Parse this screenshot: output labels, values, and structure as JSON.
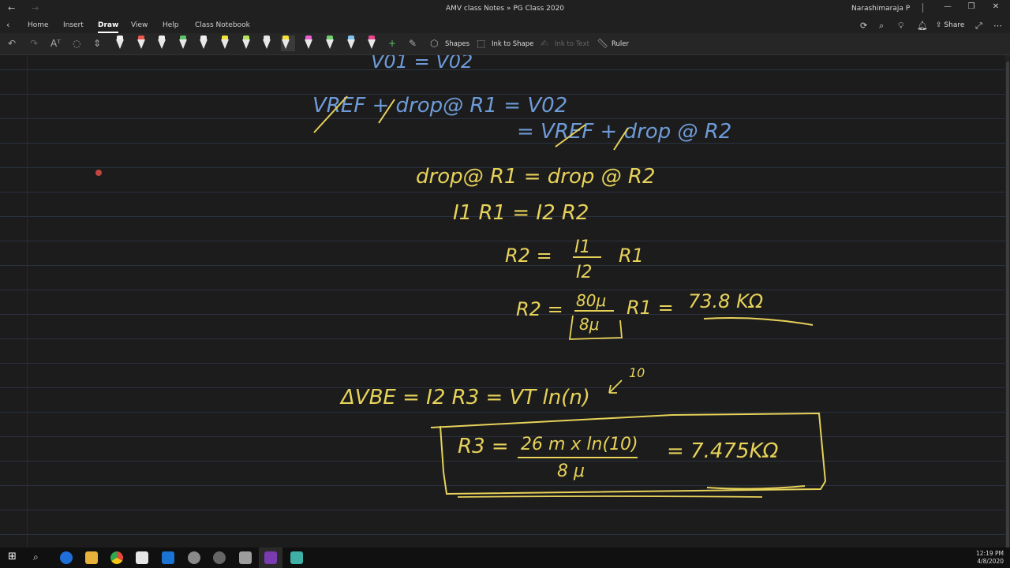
{
  "window": {
    "title": "AMV class Notes » PG Class 2020",
    "user": "Narashimaraja P"
  },
  "ribbon": {
    "tabs": [
      "Home",
      "Insert",
      "Draw",
      "View",
      "Help",
      "Class Notebook"
    ],
    "active_tab": "Draw",
    "share_label": "Share"
  },
  "toolbar": {
    "shapes_label": "Shapes",
    "ink_to_shape_label": "Ink to Shape",
    "ink_to_text_label": "Ink to Text",
    "ruler_label": "Ruler",
    "pen_colors": [
      "#f2f2f2",
      "#e8584f",
      "#eeeeee",
      "#5ec26b",
      "#f0f0f0",
      "#f4e23a",
      "#b4e45a",
      "#e6e6e6",
      "#f4e23a",
      "#e85fd0",
      "#6fd06f",
      "#7ec3f0",
      "#e8478e"
    ]
  },
  "notes": {
    "line1": "V01 = V02",
    "line2a": "VREF + drop@ R1 = V02",
    "line2b": "= VREF + drop @ R2",
    "eq1": "drop@ R1 = drop @ R2",
    "eq2": "I1 R1 = I2 R2",
    "eq3_lhs": "R2 =",
    "eq3_num": "I1",
    "eq3_den": "I2",
    "eq3_rhs": "R1",
    "eq4_lhs": "R2 =",
    "eq4_num": "80μ",
    "eq4_den": "8μ",
    "eq4_mid": "R1 =",
    "eq4_result": "73.8 KΩ",
    "eq5": "ΔVBE = I2 R3 = VT ln(n)",
    "eq5_sup": "10",
    "eq6_lhs": "R3 =",
    "eq6_num": "26 m x ln(10)",
    "eq6_den": "8 μ",
    "eq6_result": "= 7.475KΩ"
  },
  "taskbar": {
    "time": "12:19 PM",
    "date": "4/8/2020"
  }
}
